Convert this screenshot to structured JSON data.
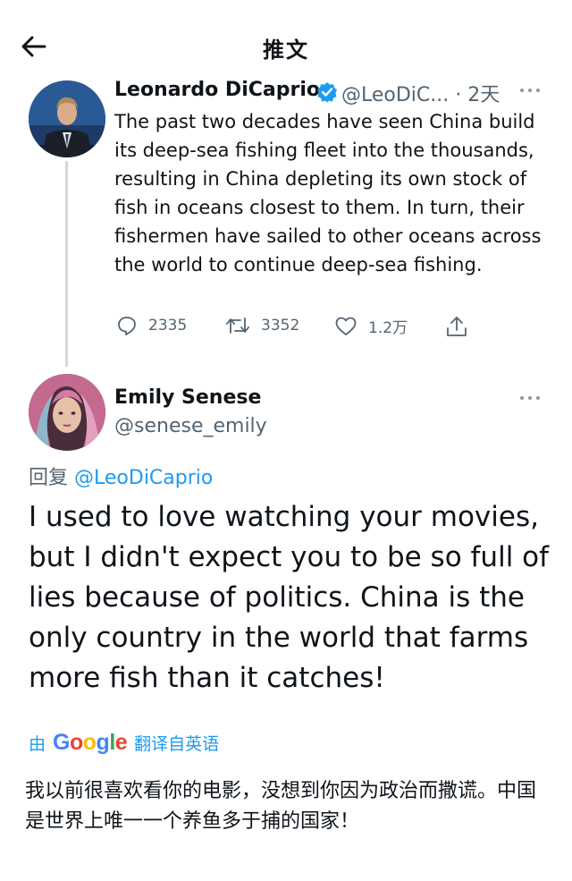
{
  "header": {
    "title": "推文",
    "back_icon": "arrow-left-icon"
  },
  "tweet": {
    "author_name": "Leonardo DiCaprio",
    "verified_icon": "verified-badge-icon",
    "handle_time": "@LeoDiC... · 2天",
    "text": "The past two decades have seen China build its deep-sea fishing fleet into the thousands, resulting in China depleting its own stock of fish in oceans closest to them. In turn, their fishermen have sailed to other oceans across the world to continue deep-sea fishing.",
    "actions": {
      "replies": "2335",
      "retweets": "3352",
      "likes": "1.2万"
    }
  },
  "reply": {
    "author_name": "Emily Senese",
    "handle": "@senese_emily",
    "reply_prefix": "回复",
    "reply_to": "@LeoDiCaprio",
    "text": "I used to love watching your movies, but I didn't expect you to be so full of lies because of politics. China is the only country in the world that farms more fish than it catches!",
    "translate_by": "由",
    "translate_brand": "Google",
    "translate_label": "翻译自英语",
    "translated_text": "我以前很喜欢看你的电影，没想到你因为政治而撒谎。中国是世界上唯一一个养鱼多于捕的国家！"
  },
  "colors": {
    "accent": "#1d9bf0",
    "muted": "#536471",
    "text": "#0f1419"
  }
}
